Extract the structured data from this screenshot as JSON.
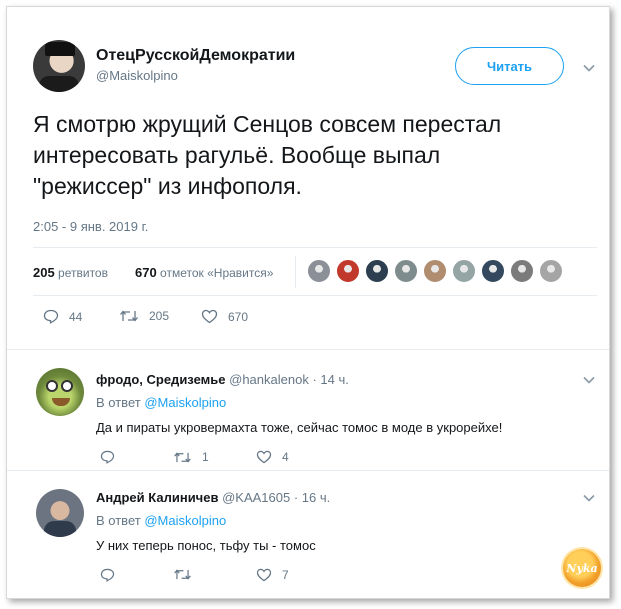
{
  "main_tweet": {
    "author_name": "ОтецРусскойДемократии",
    "author_handle": "@Maiskolpino",
    "follow_label": "Читать",
    "text_lines": [
      "Я смотрю жрущий Сенцов совсем перестал",
      "интересовать рагульё. Вообще выпал",
      "\"режиссер\" из инфополя."
    ],
    "timestamp": "2:05 - 9 янв. 2019 г.",
    "retweets_count": "205",
    "retweets_label": "ретвитов",
    "likes_count": "670",
    "likes_label": "отметок «Нравится»",
    "actions": {
      "replies": "44",
      "retweets": "205",
      "likes": "670"
    },
    "liker_colors": [
      "#8a8f98",
      "#c0392b",
      "#2c3e50",
      "#7f8c8d",
      "#b08d6e",
      "#95a5a6",
      "#34495e",
      "#7b7b7b",
      "#a5a5a5"
    ]
  },
  "replies": [
    {
      "author_name": "фродо, Средиземье",
      "author_handle": "@hankalenok",
      "age": "· 14 ч.",
      "reply_to_label": "В ответ",
      "reply_to_mention": "@Maiskolpino",
      "text": "Да и пираты укровермахта тоже, сейчас томос в моде в укрорейхе!",
      "actions": {
        "replies": "",
        "retweets": "1",
        "likes": "4"
      }
    },
    {
      "author_name": "Андрей Калиничев",
      "author_handle": "@KAA1605",
      "age": "· 16 ч.",
      "reply_to_label": "В ответ",
      "reply_to_mention": "@Maiskolpino",
      "text": "У них теперь понос, тьфу ты - томос",
      "actions": {
        "replies": "",
        "retweets": "",
        "likes": "7"
      }
    }
  ],
  "watermark_text": "Nyka",
  "colors": {
    "accent": "#1da1f2",
    "muted": "#657786",
    "border": "#e6ecf0"
  },
  "icons": [
    "chevron-down-icon",
    "reply-icon",
    "retweet-icon",
    "like-icon"
  ]
}
